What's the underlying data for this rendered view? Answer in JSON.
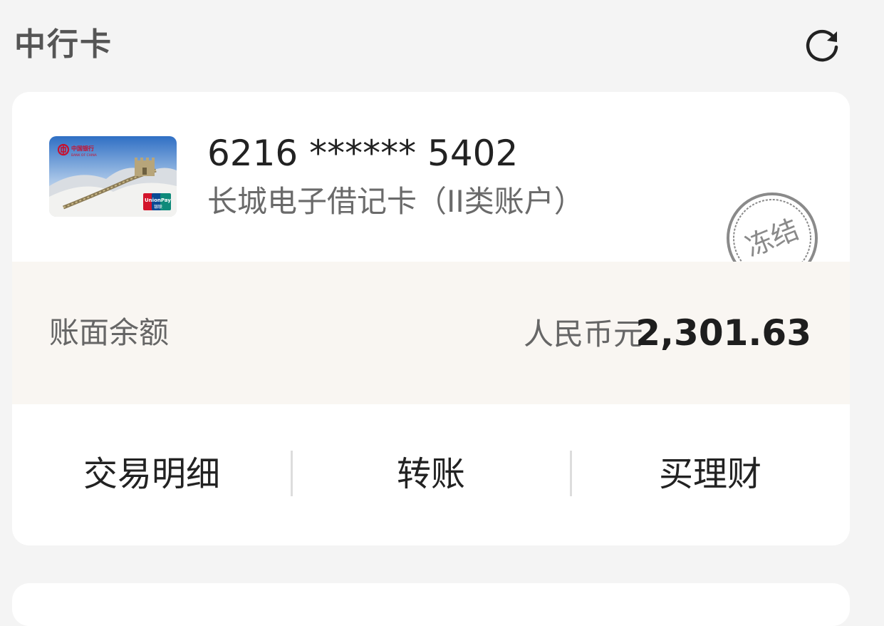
{
  "header": {
    "title": "中行卡",
    "refresh_icon": "refresh-icon"
  },
  "card": {
    "thumbnail": {
      "bank_logo_text": "中国银行",
      "bank_logo_en": "BANK OF CHINA",
      "network_logo_text": "UnionPay 银联",
      "image": "great-wall-card-art"
    },
    "number": "6216 ****** 5402",
    "type": "长城电子借记卡（II类账户）",
    "status_stamp": "冻结",
    "colors": {
      "stamp": "#8a8a8a",
      "balance_band": "#f9f6f2"
    }
  },
  "balance": {
    "label": "账面余额",
    "currency": "人民币元",
    "amount": "2,301.63"
  },
  "actions": [
    {
      "label": "交易明细"
    },
    {
      "label": "转账"
    },
    {
      "label": "买理财"
    }
  ]
}
